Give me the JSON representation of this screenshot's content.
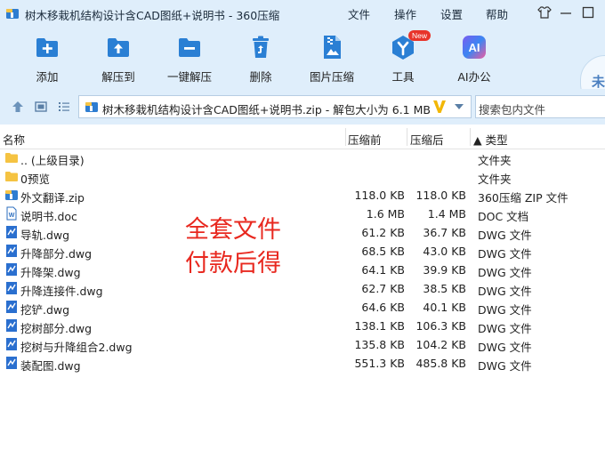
{
  "window": {
    "title": "树木移栽机结构设计含CAD图纸+说明书 - 360压缩",
    "menus": [
      "文件",
      "操作",
      "设置",
      "帮助"
    ]
  },
  "toolbar": {
    "tools": [
      {
        "label": "添加",
        "icon": "add-icon"
      },
      {
        "label": "解压到",
        "icon": "extract-to-icon"
      },
      {
        "label": "一键解压",
        "icon": "one-click-extract-icon"
      },
      {
        "label": "删除",
        "icon": "delete-icon"
      },
      {
        "label": "图片压缩",
        "icon": "image-compress-icon"
      },
      {
        "label": "工具",
        "icon": "tools-icon",
        "badge": "New"
      },
      {
        "label": "AI办公",
        "icon": "ai-office-icon",
        "glyph": "AI"
      }
    ],
    "peek_text": "未"
  },
  "address": {
    "path": "树木移栽机结构设计含CAD图纸+说明书.zip - 解包大小为 6.1 MB",
    "search_placeholder": "搜索包内文件"
  },
  "columns": {
    "name": "名称",
    "size": "压缩前",
    "compressed": "压缩后",
    "type": "▲ 类型"
  },
  "files": [
    {
      "name": ".. (上级目录)",
      "size": "",
      "compressed": "",
      "type": "文件夹",
      "icon": "folder-up-icon"
    },
    {
      "name": "0预览",
      "size": "",
      "compressed": "",
      "type": "文件夹",
      "icon": "folder-icon"
    },
    {
      "name": "外文翻译.zip",
      "size": "118.0 KB",
      "compressed": "118.0 KB",
      "type": "360压缩 ZIP 文件",
      "icon": "zip-icon"
    },
    {
      "name": "说明书.doc",
      "size": "1.6 MB",
      "compressed": "1.4 MB",
      "type": "DOC 文档",
      "icon": "doc-icon"
    },
    {
      "name": "导轨.dwg",
      "size": "61.2 KB",
      "compressed": "36.7 KB",
      "type": "DWG 文件",
      "icon": "dwg-icon"
    },
    {
      "name": "升降部分.dwg",
      "size": "68.5 KB",
      "compressed": "43.0 KB",
      "type": "DWG 文件",
      "icon": "dwg-icon"
    },
    {
      "name": "升降架.dwg",
      "size": "64.1 KB",
      "compressed": "39.9 KB",
      "type": "DWG 文件",
      "icon": "dwg-icon"
    },
    {
      "name": "升降连接件.dwg",
      "size": "62.7 KB",
      "compressed": "38.5 KB",
      "type": "DWG 文件",
      "icon": "dwg-icon"
    },
    {
      "name": "挖铲.dwg",
      "size": "64.6 KB",
      "compressed": "40.1 KB",
      "type": "DWG 文件",
      "icon": "dwg-icon"
    },
    {
      "name": "挖树部分.dwg",
      "size": "138.1 KB",
      "compressed": "106.3 KB",
      "type": "DWG 文件",
      "icon": "dwg-icon"
    },
    {
      "name": "挖树与升降组合2.dwg",
      "size": "135.8 KB",
      "compressed": "104.2 KB",
      "type": "DWG 文件",
      "icon": "dwg-icon"
    },
    {
      "name": "装配图.dwg",
      "size": "551.3 KB",
      "compressed": "485.8 KB",
      "type": "DWG 文件",
      "icon": "dwg-icon"
    }
  ],
  "overlay": {
    "line1": "全套文件",
    "line2": "付款后得"
  },
  "colors": {
    "chrome_bg": "#dfeefb",
    "accent_blue": "#2a7fd4",
    "overlay_red": "#e8281f",
    "folder_yellow": "#f5c342"
  }
}
